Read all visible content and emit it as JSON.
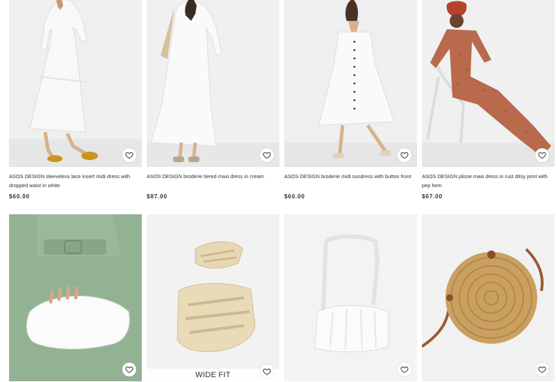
{
  "products": [
    {
      "title": "ASOS DESIGN sleeveless lace insert midi dress with dropped waist in white",
      "price": "$60.00",
      "image": "white-lace-midi-dress"
    },
    {
      "title": "ASOS DESIGN broderie tiered maxi dress in cream",
      "price": "$87.00",
      "image": "cream-broderie-maxi-dress"
    },
    {
      "title": "ASOS DESIGN broderie midi sundress with button front",
      "price": "$60.00",
      "image": "white-button-sundress"
    },
    {
      "title": "ASOS DESIGN plisse maxi dress in rust ditsy print with pep hem",
      "price": "$67.00",
      "image": "rust-plisse-maxi-dress"
    },
    {
      "image": "white-pouch-clutch-bag"
    },
    {
      "image": "straw-strappy-flat-sandals",
      "badge": "WIDE FIT"
    },
    {
      "image": "white-ruched-shoulder-bag"
    },
    {
      "image": "round-rattan-crossbody-bag"
    }
  ],
  "colors": {
    "text": "#2d2d2d",
    "image_bg": "#ededed",
    "heart_bg": "#ffffff"
  },
  "icons": {
    "save": "heart-icon"
  }
}
